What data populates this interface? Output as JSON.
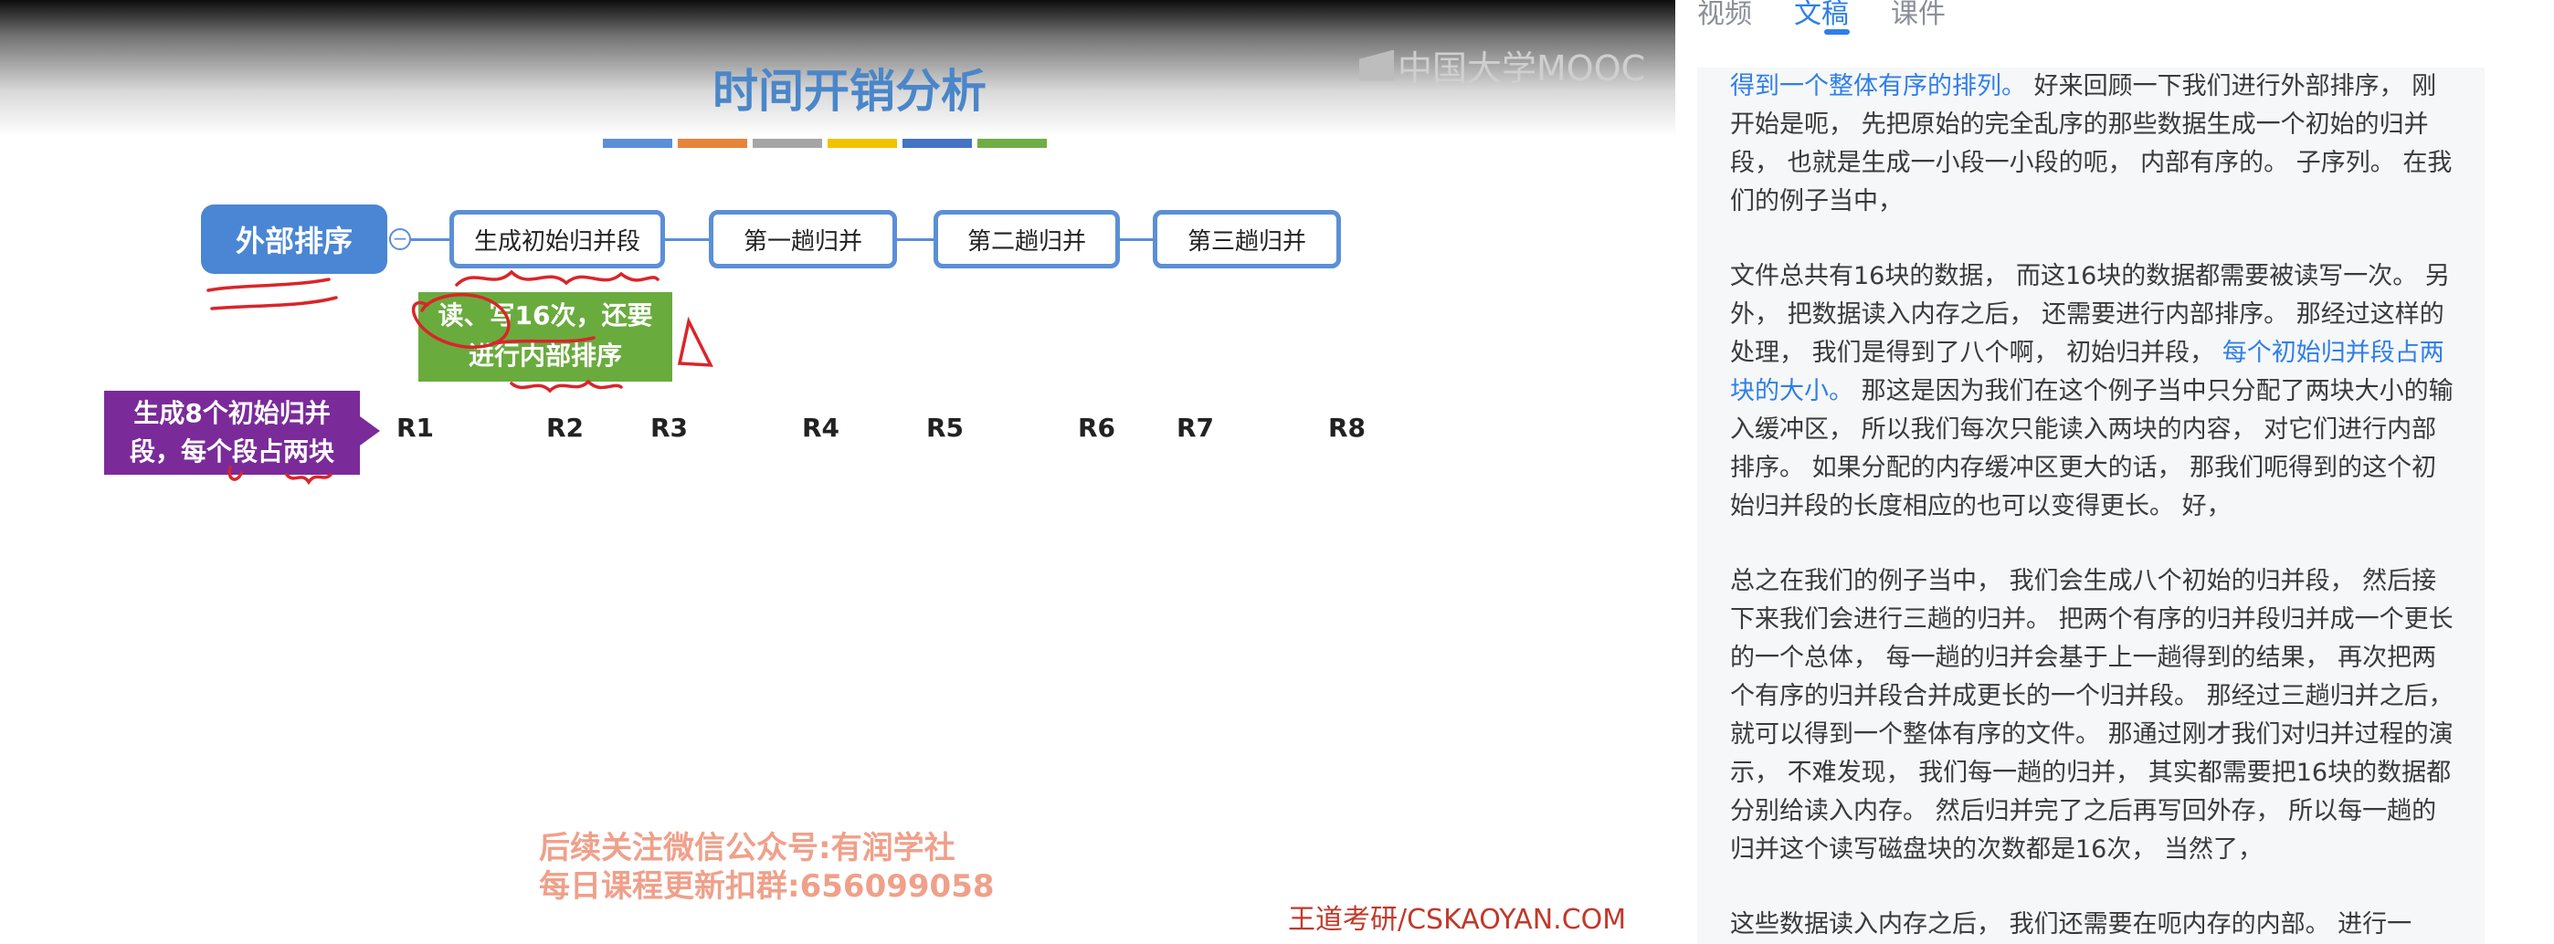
{
  "video": {
    "title": "时间开销分析",
    "logo": "中国大学MOOC",
    "colorbar": [
      "#5b8fd6",
      "#e8833a",
      "#a5a5a5",
      "#f2c200",
      "#4472c4",
      "#70ad47"
    ],
    "mindmap": {
      "root": "外部排序",
      "collapse_icon": "−",
      "nodes": [
        "生成初始归并段",
        "第一趟归并",
        "第二趟归并",
        "第三趟归并"
      ],
      "green_note": [
        "读、写16次，还要",
        "进行内部排序"
      ],
      "purple_note": [
        "生成8个初始归并",
        "段，每个段占两块"
      ],
      "runs": [
        "R1",
        "R2",
        "R3",
        "R4",
        "R5",
        "R6",
        "R7",
        "R8"
      ]
    },
    "promo": [
      "后续关注微信公众号:有润学社",
      "每日课程更新扣群:656099058"
    ],
    "watermark": "王道考研/CSKAOYAN.COM"
  },
  "sidebar": {
    "tabs": [
      {
        "label": "视频",
        "active": false
      },
      {
        "label": "文稿",
        "active": true
      },
      {
        "label": "课件",
        "active": false
      }
    ],
    "transcript": [
      [
        {
          "t": "得到一个整体有序的排列。",
          "hl": true
        },
        {
          "t": " 好来回顾一下我们进行外部排序， 刚开始是呃， 先把原始的完全乱序的那些数据生成一个初始的归并段， 也就是生成一小段一小段的呃， 内部有序的。 子序列。 在我们的例子当中，",
          "hl": false
        }
      ],
      [
        {
          "t": "文件总共有16块的数据， 而这16块的数据都需要被读写一次。 另外， 把数据读入内存之后， 还需要进行内部排序。 那经过这样的处理， 我们是得到了八个啊， 初始归并段， ",
          "hl": false
        },
        {
          "t": "每个初始归并段占两块的大小。",
          "hl": true
        },
        {
          "t": " 那这是因为我们在这个例子当中只分配了两块大小的输入缓冲区， 所以我们每次只能读入两块的内容， 对它们进行内部排序。 如果分配的内存缓冲区更大的话， 那我们呃得到的这个初始归并段的长度相应的也可以变得更长。 好，",
          "hl": false
        }
      ],
      [
        {
          "t": "总之在我们的例子当中， 我们会生成八个初始的归并段， 然后接下来我们会进行三趟的归并。 把两个有序的归并段归并成一个更长的一个总体， 每一趟的归并会基于上一趟得到的结果， 再次把两个有序的归并段合并成更长的一个归并段。 那经过三趟归并之后， 就可以得到一个整体有序的文件。 那通过刚才我们对归并过程的演示， 不难发现， 我们每一趟的归并， 其实都需要把16块的数据都分别给读入内存。 然后归并完了之后再写回外存， 所以每一趟的归并这个读写磁盘块的次数都是16次， 当然了，",
          "hl": false
        }
      ],
      [
        {
          "t": "这些数据读入内存之后， 我们还需要在呃内存的内部。 进行一",
          "hl": false
        }
      ]
    ]
  }
}
